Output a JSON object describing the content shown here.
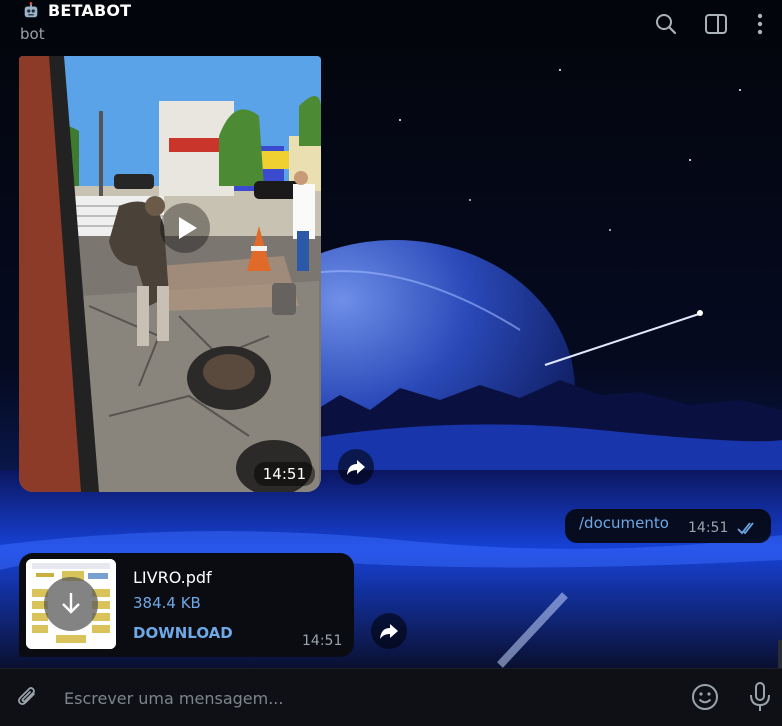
{
  "header": {
    "title": "BETABOT",
    "status": "bot",
    "icons": [
      "robot-icon",
      "search-icon",
      "sidebar-toggle-icon",
      "more-vertical-icon"
    ]
  },
  "messages": {
    "video": {
      "time": "14:51",
      "icons": [
        "play-icon",
        "forward-icon"
      ]
    },
    "outgoing": {
      "text": "/documento",
      "time": "14:51",
      "status_icon": "double-check-icon"
    },
    "file": {
      "name": "LIVRO.pdf",
      "size": "384.4 KB",
      "action": "DOWNLOAD",
      "time": "14:51",
      "icons": [
        "download-icon",
        "forward-icon"
      ]
    }
  },
  "composer": {
    "placeholder": "Escrever uma mensagem...",
    "icons": [
      "paperclip-icon",
      "emoji-icon",
      "microphone-icon"
    ]
  },
  "colors": {
    "accent": "#6fa8e6",
    "bubble": "#0b0c12",
    "composer_bg": "#0e1016",
    "muted_text": "#9ba3ab"
  }
}
